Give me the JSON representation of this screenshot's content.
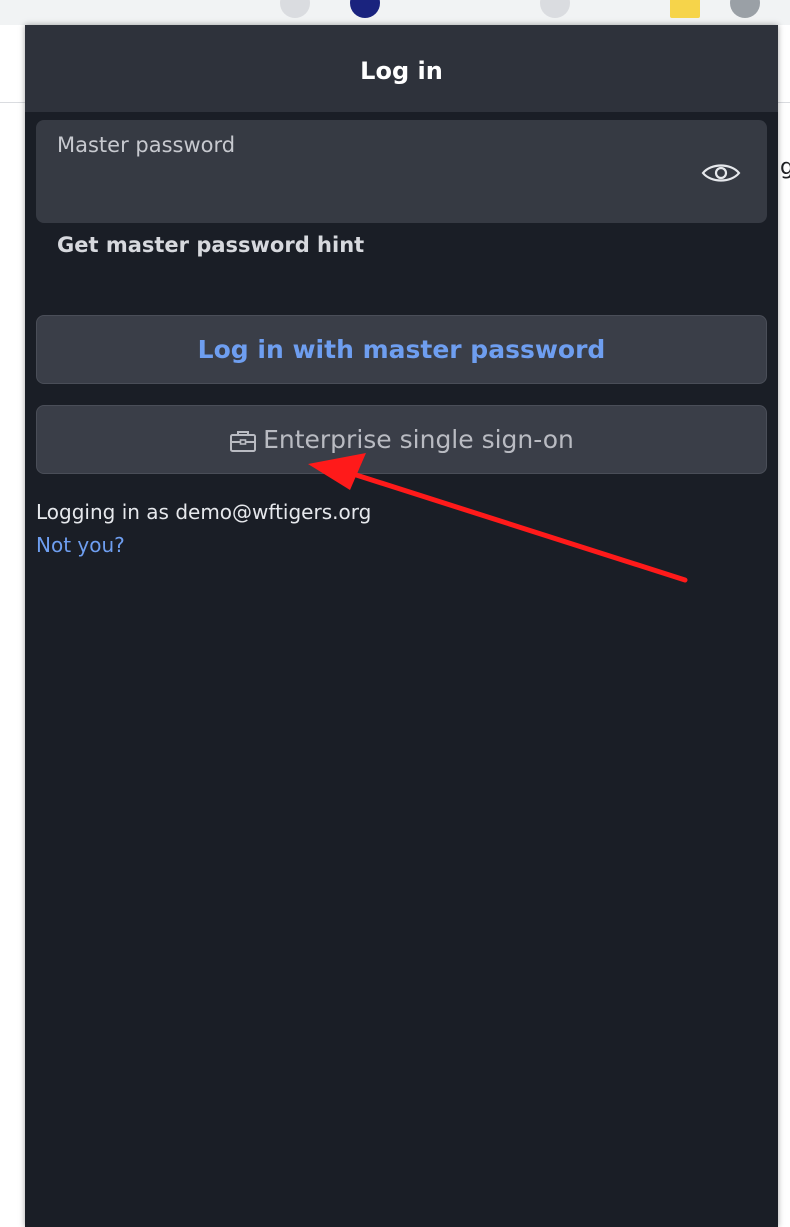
{
  "background": {
    "partial_text": "g"
  },
  "header": {
    "title": "Log in"
  },
  "password_field": {
    "label": "Master password",
    "value": "",
    "toggle_icon": "eye-icon"
  },
  "hint_link": "Get master password hint",
  "buttons": {
    "login_master": "Log in with master password",
    "enterprise_sso": "Enterprise single sign-on",
    "enterprise_sso_icon": "briefcase-icon"
  },
  "account": {
    "logging_in_as": "Logging in as demo@wftigers.org",
    "not_you": "Not you?"
  },
  "colors": {
    "popup_bg": "#1a1e26",
    "header_bg": "#2e323b",
    "accent": "#6e9ef0",
    "annotation_arrow": "#ff1a1a"
  }
}
